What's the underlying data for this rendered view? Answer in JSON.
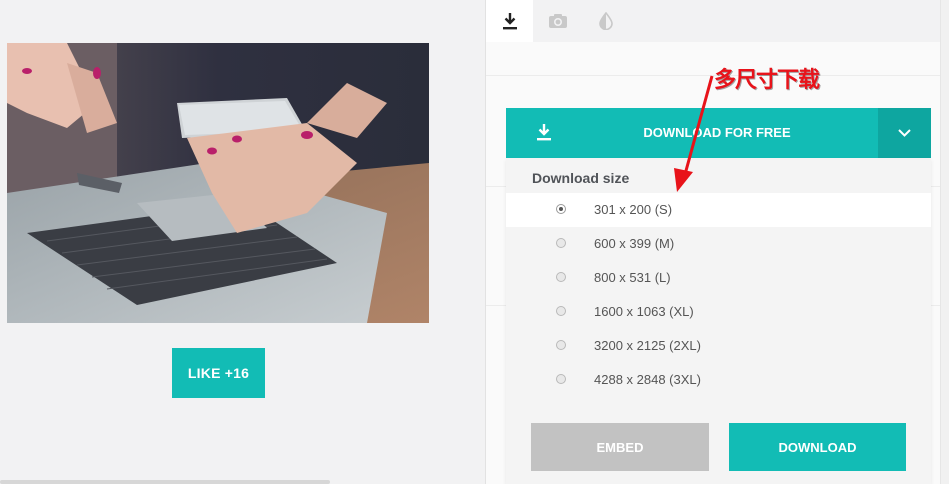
{
  "like_button": {
    "label": "LIKE +16"
  },
  "tabs": [
    {
      "name": "download",
      "icon": "download-icon",
      "active": true
    },
    {
      "name": "photo",
      "icon": "camera-icon",
      "active": false
    },
    {
      "name": "filter",
      "icon": "contrast-icon",
      "active": false
    }
  ],
  "download_bar": {
    "label": "DOWNLOAD FOR FREE",
    "icon": "download-icon",
    "toggle_icon": "chevron-down-icon"
  },
  "dropdown": {
    "title": "Download size",
    "options": [
      {
        "label": "301 x 200 (S)",
        "selected": true
      },
      {
        "label": "600 x 399 (M)",
        "selected": false
      },
      {
        "label": "800 x 531 (L)",
        "selected": false
      },
      {
        "label": "1600 x 1063 (XL)",
        "selected": false
      },
      {
        "label": "3200 x 2125 (2XL)",
        "selected": false
      },
      {
        "label": "4288 x 2848 (3XL)",
        "selected": false
      }
    ],
    "embed_label": "EMBED",
    "download_label": "DOWNLOAD"
  },
  "annotation": {
    "text": "多尺寸下载",
    "color": "#e8131a"
  },
  "colors": {
    "accent": "#12bcb5",
    "accent_dark": "#0ea6a0",
    "embed_gray": "#c2c2c2"
  }
}
